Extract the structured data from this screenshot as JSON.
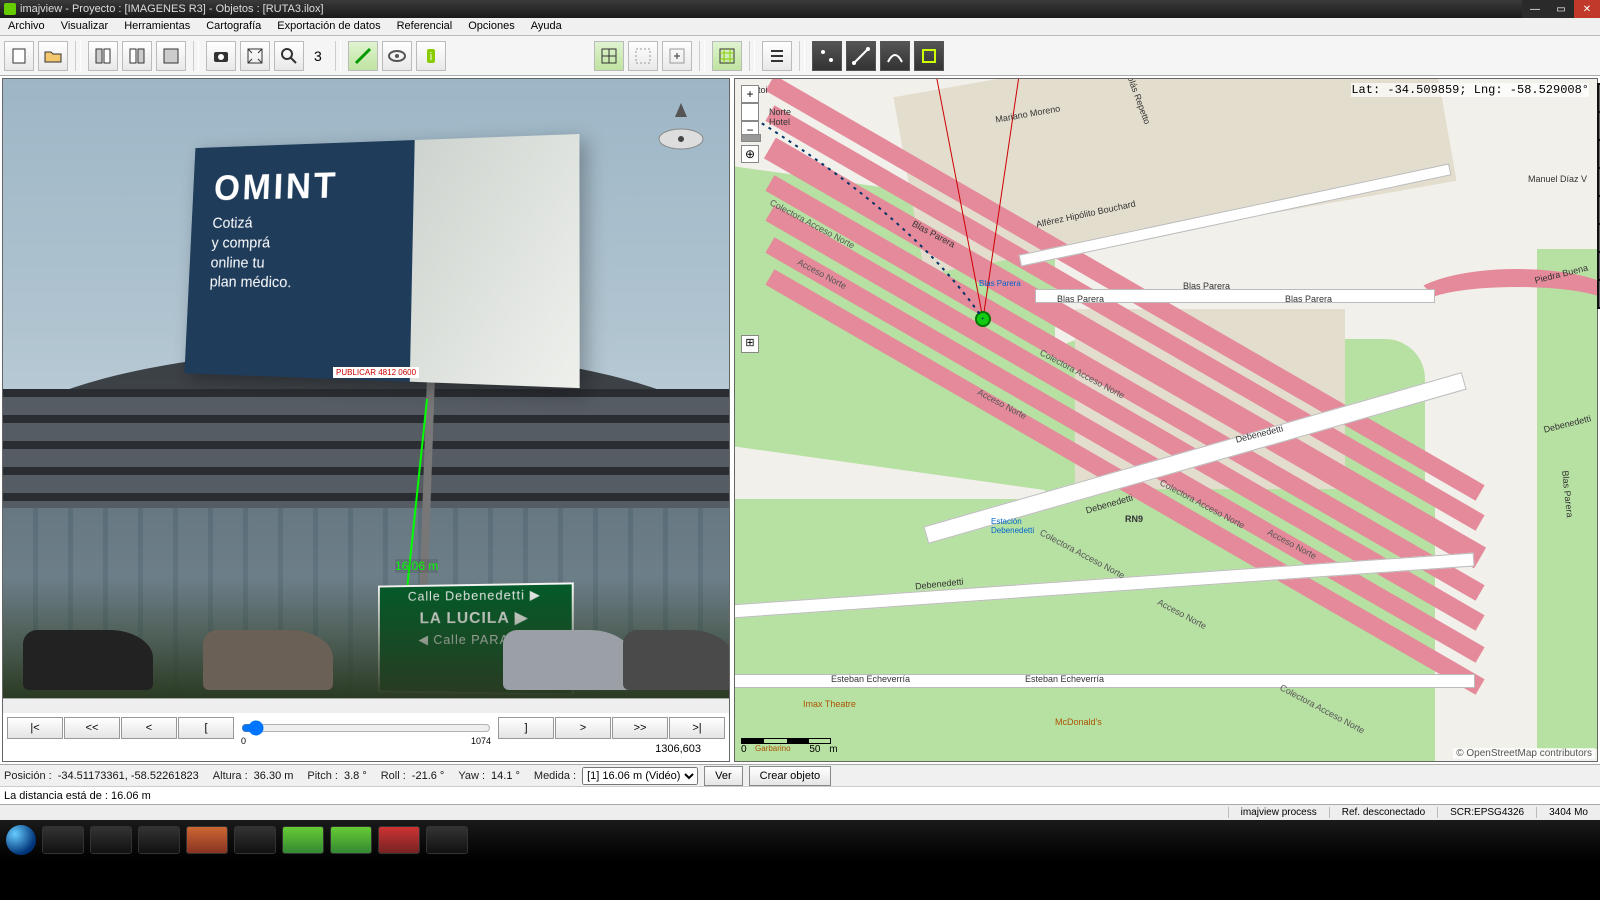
{
  "title": "imajview - Proyecto : [IMAGENES R3] - Objetos : [RUTA3.ilox]",
  "menu": [
    "Archivo",
    "Visualizar",
    "Herramientas",
    "Cartografía",
    "Exportación de datos",
    "Referencial",
    "Opciones",
    "Ayuda"
  ],
  "toolbar_badge": "3",
  "photo": {
    "billboard_brand": "OMINT",
    "billboard_sub": "Cotizá\ny comprá\nonline tu\nplan médico.",
    "publicar": "PUBLICAR 4812 0600",
    "measure": "16.06 m",
    "sign_l1": "Calle Debenedetti ▶",
    "sign_l2": "LA LUCILA ▶",
    "sign_l3": "◀ Calle PARANA"
  },
  "nav": {
    "first": "|<",
    "prev2": "<<",
    "prev": "<",
    "bracket_open": "[",
    "bracket_close": "]",
    "next": ">",
    "next2": ">>",
    "last": ">|",
    "slider_min": "0",
    "slider_max": "1074",
    "frame": "1306,603"
  },
  "map": {
    "coords": "Lat: -34.509859; Lng: -58.529008°",
    "labels": {
      "auto": "Autoi",
      "norte_hotel": "Norte\nHotel",
      "mariano_moreno": "Mariano Moreno",
      "nicolas_repetto": "Nicolás Repetto",
      "manuel_diaz": "Manuel Díaz V",
      "alferez": "Alférez Hipólito Bouchard",
      "blas_parera": "Blas Parera",
      "piedra_buena": "Piedra Buena",
      "colectora": "Colectora Acceso Norte",
      "acceso_norte": "Acceso Norte",
      "debenedetti": "Debenedetti",
      "rn9": "RN9",
      "estacion": "Estación\nDebenedetti",
      "esteban": "Esteban Echeverría",
      "imax": "Imax Theatre",
      "mcdonalds": "McDonald's",
      "garbarino": "Garbarino"
    },
    "scale": {
      "zero": "0",
      "fifty": "50",
      "unit": "m"
    },
    "attribution": "© OpenStreetMap contributors"
  },
  "status": {
    "posicion_lbl": "Posición :",
    "posicion": "-34.51173361, -58.52261823",
    "altura_lbl": "Altura :",
    "altura": "36.30 m",
    "pitch_lbl": "Pitch :",
    "pitch": "3.8 °",
    "roll_lbl": "Roll :",
    "roll": "-21.6 °",
    "yaw_lbl": "Yaw :",
    "yaw": "14.1 °",
    "medida_lbl": "Medida :",
    "medida_opt": "[1] 16.06 m (Vidéo)",
    "ver": "Ver",
    "crear": "Crear objeto"
  },
  "distance": "La distancia está de : 16.06 m",
  "bottom": {
    "process": "imajview process",
    "ref": "Ref. desconectado",
    "scr": "SCR:EPSG4326",
    "mem": "3404 Mo"
  }
}
